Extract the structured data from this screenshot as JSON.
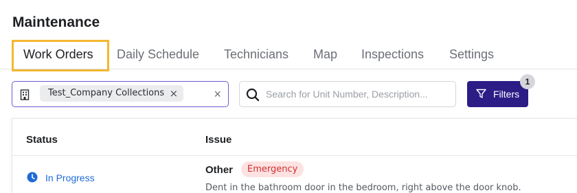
{
  "page": {
    "title": "Maintenance"
  },
  "tabs": [
    {
      "label": "Work Orders",
      "active": true
    },
    {
      "label": "Daily Schedule",
      "active": false
    },
    {
      "label": "Technicians",
      "active": false
    },
    {
      "label": "Map",
      "active": false
    },
    {
      "label": "Inspections",
      "active": false
    },
    {
      "label": "Settings",
      "active": false
    }
  ],
  "toolbar": {
    "collection_chip": "Test_Company Collections",
    "chip_remove": "×",
    "clear": "×",
    "search_placeholder": "Search for Unit Number, Description...",
    "search_value": "",
    "filters_label": "Filters",
    "filters_badge": "1"
  },
  "table": {
    "columns": [
      "Status",
      "Issue"
    ],
    "rows": [
      {
        "status": "In Progress",
        "issue_title": "Other",
        "priority": "Emergency",
        "description": "Dent in the bathroom door in the bedroom, right above the door knob."
      }
    ]
  },
  "colors": {
    "accent": "#2b1c86",
    "focus_ring": "#f5b731",
    "status_in_progress": "#1f6bd6",
    "emergency_text": "#d32f2f",
    "emergency_bg": "#fde2e2"
  },
  "icons": {
    "collection": "building-icon",
    "search": "search-icon",
    "filter": "filter-icon",
    "status": "clock-icon"
  }
}
